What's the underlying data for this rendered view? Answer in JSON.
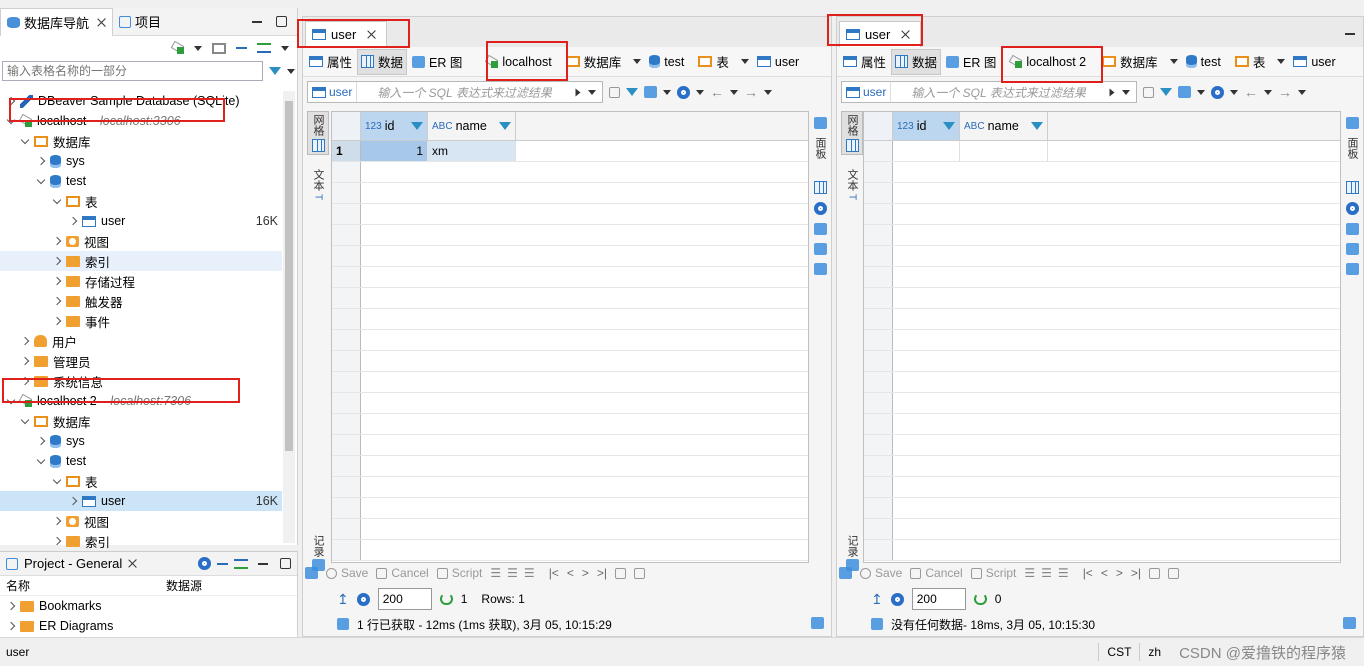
{
  "nav": {
    "tabs": [
      {
        "label": "数据库导航"
      },
      {
        "label": "项目"
      }
    ],
    "filter_placeholder": "输入表格名称的一部分",
    "tree": [
      {
        "label": "DBeaver Sample Database (SQLite)",
        "sub": ""
      },
      {
        "label": "localhost",
        "sub": "- localhost:3306"
      },
      {
        "label": "数据库"
      },
      {
        "label": "sys"
      },
      {
        "label": "test"
      },
      {
        "label": "表"
      },
      {
        "label": "user",
        "size": "16K"
      },
      {
        "label": "视图"
      },
      {
        "label": "索引"
      },
      {
        "label": "存储过程"
      },
      {
        "label": "触发器"
      },
      {
        "label": "事件"
      },
      {
        "label": "用户"
      },
      {
        "label": "管理员"
      },
      {
        "label": "系统信息"
      },
      {
        "label": "localhost 2",
        "sub": "- localhost:7306"
      },
      {
        "label": "数据库"
      },
      {
        "label": "sys"
      },
      {
        "label": "test"
      },
      {
        "label": "表"
      },
      {
        "label": "user",
        "size": "16K"
      },
      {
        "label": "视图"
      },
      {
        "label": "索引"
      }
    ]
  },
  "project": {
    "title": "Project - General",
    "col_name": "名称",
    "col_source": "数据源",
    "items": [
      {
        "label": "Bookmarks"
      },
      {
        "label": "ER Diagrams"
      }
    ]
  },
  "editor1": {
    "tab": "user",
    "subtabs": {
      "props": "属性",
      "data": "数据",
      "er": "ER 图",
      "conn": "localhost",
      "db": "数据库",
      "schema": "test",
      "table": "表",
      "obj": "user"
    },
    "filter_table": "user",
    "filter_placeholder": "输入一个 SQL 表达式来过滤结果",
    "side_grid": "网格",
    "side_text": "文本",
    "side_record": "记录",
    "side_panel": "面板",
    "columns": [
      {
        "type": "123",
        "name": "id"
      },
      {
        "type": "ABC",
        "name": "name"
      }
    ],
    "rows": [
      {
        "num": "1",
        "id": "1",
        "name": "xm"
      }
    ],
    "actions": {
      "save": "Save",
      "cancel": "Cancel",
      "script": "Script"
    },
    "fetch_size": "200",
    "row_count": "1",
    "rows_label": "Rows: 1",
    "info": "1 行已获取 - 12ms (1ms 获取), 3月 05, 10:15:29"
  },
  "editor2": {
    "tab": "user",
    "subtabs": {
      "props": "属性",
      "data": "数据",
      "er": "ER 图",
      "conn": "localhost 2",
      "db": "数据库",
      "schema": "test",
      "table": "表",
      "obj": "user"
    },
    "filter_table": "user",
    "filter_placeholder": "输入一个 SQL 表达式来过滤结果",
    "side_grid": "网格",
    "side_text": "文本",
    "side_record": "记录",
    "side_panel": "面板",
    "columns": [
      {
        "type": "123",
        "name": "id"
      },
      {
        "type": "ABC",
        "name": "name"
      }
    ],
    "actions": {
      "save": "Save",
      "cancel": "Cancel",
      "script": "Script"
    },
    "fetch_size": "200",
    "row_count": "0",
    "info": "没有任何数据- 18ms, 3月 05, 10:15:30"
  },
  "status": {
    "left": "user",
    "tz": "CST",
    "lang": "zh",
    "watermark": "CSDN @爱撸铁的程序猿"
  }
}
